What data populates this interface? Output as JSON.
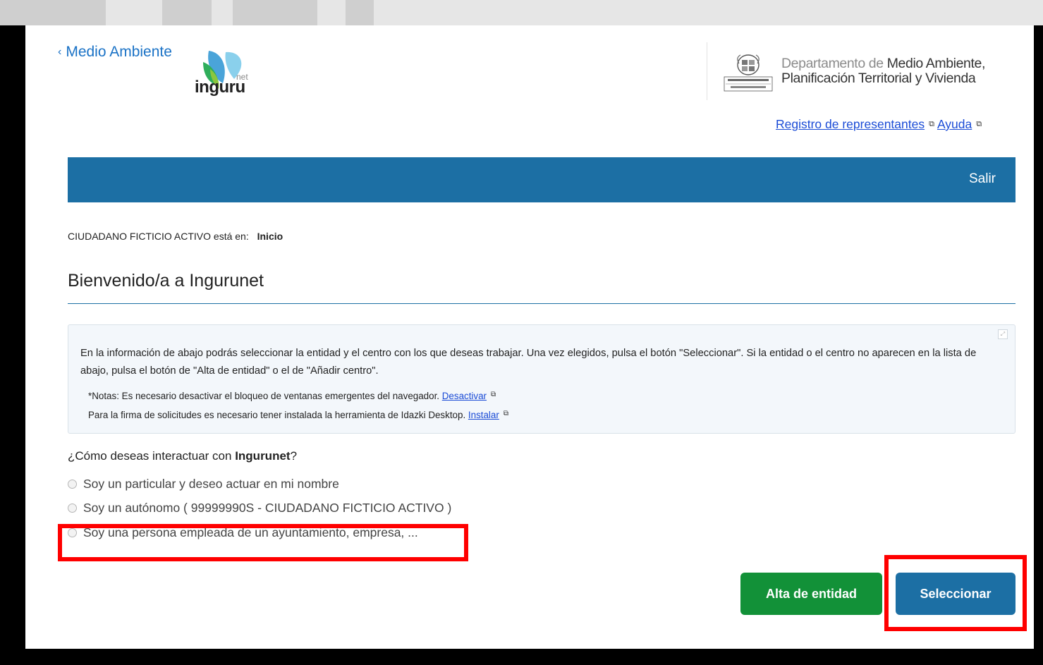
{
  "header": {
    "back_link": "Medio Ambiente",
    "logo_text": "inguru",
    "logo_suffix": "net",
    "dept_light": "Departamento de",
    "dept_line1_rest": "Medio Ambiente,",
    "dept_line2": "Planificación Territorial y Vivienda",
    "links": {
      "registro": "Registro de representantes",
      "ayuda": "Ayuda"
    }
  },
  "nav": {
    "exit_label": "Salir"
  },
  "breadcrumb": {
    "user_text": "CIUDADANO FICTICIO ACTIVO está en:",
    "current": "Inicio"
  },
  "page": {
    "title": "Bienvenido/a a Ingurunet"
  },
  "info": {
    "text": "En la información de abajo podrás seleccionar la entidad y el centro con los que deseas trabajar. Una vez elegidos, pulsa el botón \"Seleccionar\". Si la entidad o el centro no aparecen en la lista de abajo, pulsa el botón de \"Alta de entidad\" o el de \"Añadir centro\".",
    "note1": "*Notas: Es necesario desactivar el bloqueo de ventanas emergentes del navegador.",
    "note1_link": "Desactivar",
    "note2": "Para la firma de solicitudes es necesario tener instalada la herramienta de Idazki Desktop.",
    "note2_link": "Instalar"
  },
  "question": {
    "prefix": "¿Cómo deseas interactuar con",
    "bold": "Ingurunet",
    "suffix": "?"
  },
  "options": [
    "Soy un particular y deseo actuar en mi nombre",
    "Soy un autónomo ( 99999990S - CIUDADANO FICTICIO ACTIVO )",
    "Soy una persona empleada de un ayuntamiento, empresa, ..."
  ],
  "buttons": {
    "alta": "Alta de entidad",
    "seleccionar": "Seleccionar"
  },
  "colors": {
    "brand_blue": "#1c6fa4",
    "link_blue": "#1a4bd6",
    "green": "#129138",
    "highlight": "#ff0000"
  }
}
